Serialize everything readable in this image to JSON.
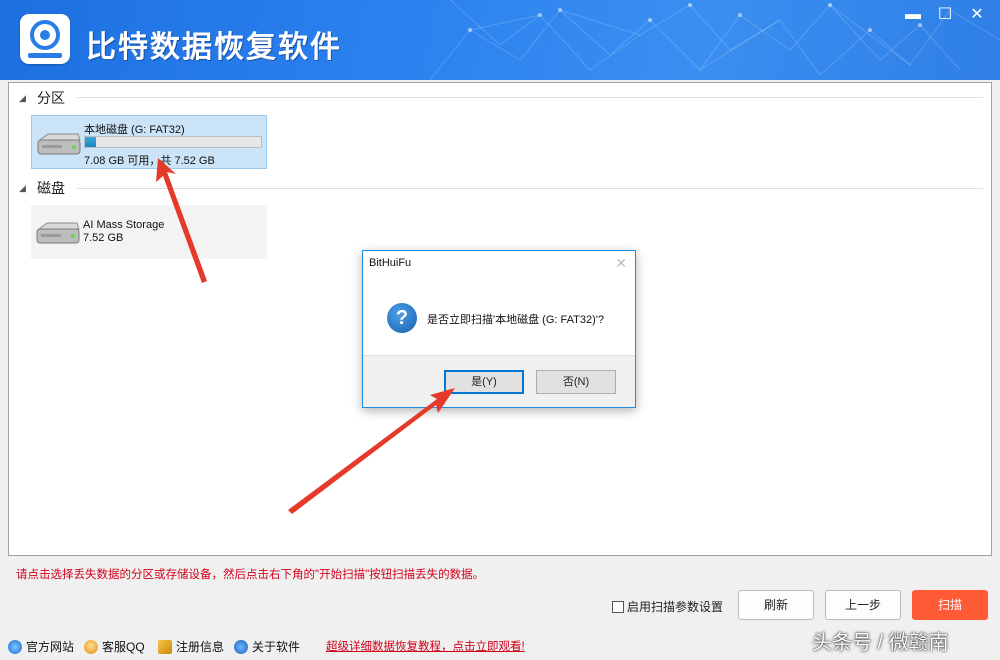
{
  "app": {
    "title": "比特数据恢复软件"
  },
  "window_controls": {
    "minimize": "▬",
    "maximize": "☐",
    "close": "✕"
  },
  "sections": [
    {
      "label": "分区"
    },
    {
      "label": "磁盘"
    }
  ],
  "partition": {
    "name": "本地磁盘 (G: FAT32)",
    "size_text": "7.08 GB 可用，共 7.52 GB",
    "used_fraction": 0.06
  },
  "disk": {
    "name": "AI Mass Storage",
    "size_text": "7.52 GB"
  },
  "hint": "请点击选择丢失数据的分区或存储设备，然后点击右下角的\"开始扫描\"按钮扫描丢失的数据。",
  "options": {
    "scan_params_label": "启用扫描参数设置",
    "scan_params_checked": false
  },
  "buttons": {
    "refresh": "刷新",
    "prev": "上一步",
    "scan": "扫描"
  },
  "footer": {
    "website": "官方网站",
    "qq": "客服QQ",
    "register": "注册信息",
    "about": "关于软件",
    "promo": "超级详细数据恢复教程，点击立即观看!"
  },
  "dialog": {
    "title": "BitHuiFu",
    "close": "✕",
    "message": "是否立即扫描'本地磁盘 (G: FAT32)'?",
    "yes": "是(Y)",
    "no": "否(N)"
  },
  "watermark": "头条号 / 微赣南",
  "colors": {
    "titlebar": "#2b82ef",
    "scan_button": "#ff5a36",
    "hint_text": "#d0021b",
    "arrow": "#e53a2a"
  }
}
